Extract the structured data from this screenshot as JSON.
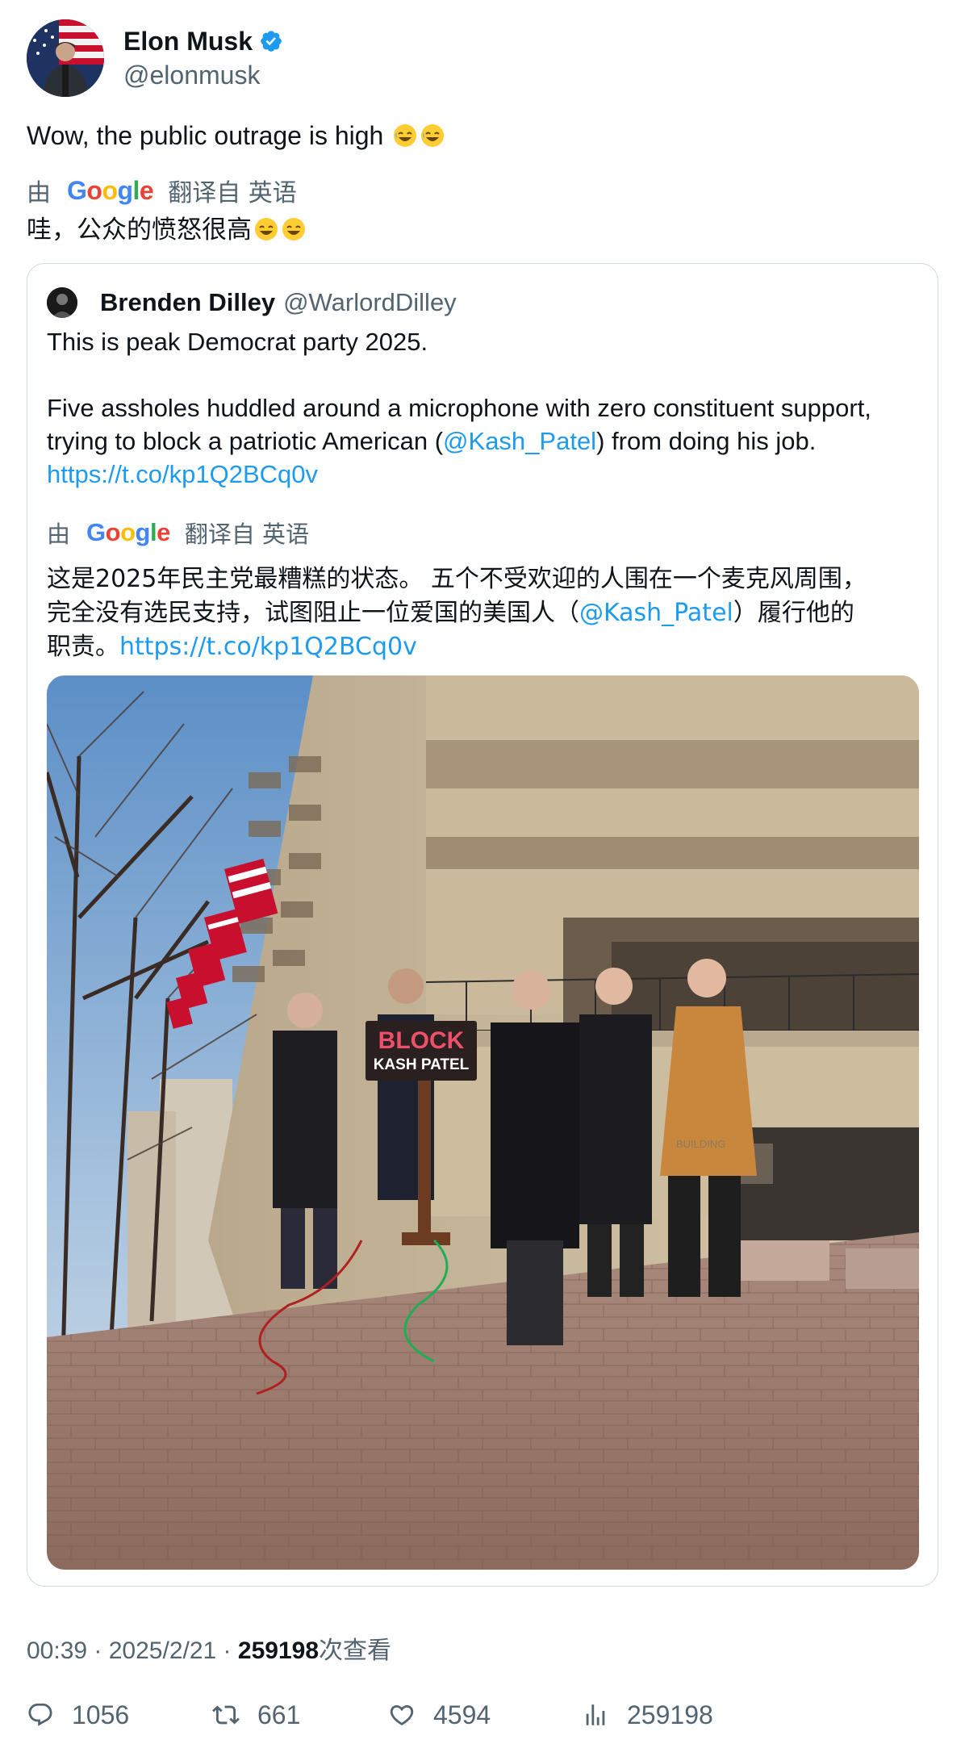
{
  "author": {
    "name": "Elon Musk",
    "handle": "@elonmusk",
    "verified": true
  },
  "tweet": {
    "text": "Wow, the public outrage is high",
    "emoji": "rolling-on-floor-laughing-emoji x2"
  },
  "translation": {
    "by": "由",
    "provider": "Google",
    "from": "翻译自 英语",
    "text": "哇，公众的愤怒很高"
  },
  "quote": {
    "name": "Brenden Dilley",
    "handle": "@WarlordDilley",
    "line1": "This is peak Democrat party 2025.",
    "line2": "Five assholes huddled around a microphone with zero constituent support,",
    "line3_before": "trying to block a patriotic American (",
    "line3_mention": "@Kash_Patel",
    "line3_after": ") from doing his job.",
    "link": "https://t.co/kp1Q2BCq0v",
    "translation": {
      "by": "由",
      "provider": "Google",
      "from": "翻译自 英语",
      "line1": "这是2025年民主党最糟糕的状态。 五个不受欢迎的人围在一个麦克风周围，",
      "line2_before": "完全没有选民支持，试图阻止一位爱国的美国人（",
      "line2_mention": "@Kash_Patel",
      "line2_after": "）履行他的",
      "line3_before": "职责。",
      "link": "https://t.co/kp1Q2BCq0v"
    },
    "photo": {
      "sign_line1": "BLOCK",
      "sign_line2": "KASH PATEL",
      "building_text": "BUILDING"
    }
  },
  "meta": {
    "time": "00:39",
    "sep1": " · ",
    "date": "2025/2/21",
    "sep2": " · ",
    "views": "259198",
    "views_label": "次查看"
  },
  "actions": {
    "replies": "1056",
    "retweets": "661",
    "likes": "4594",
    "views": "259198"
  },
  "colors": {
    "link": "#1d9bf0",
    "secondary": "#536471",
    "verified": "#1d9bf0",
    "border": "#cfd9de"
  }
}
